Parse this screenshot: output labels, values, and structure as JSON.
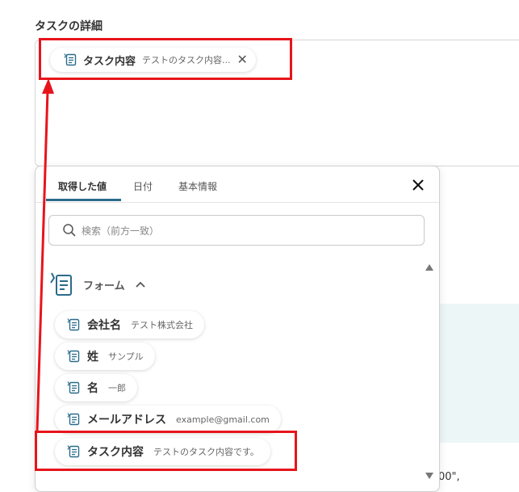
{
  "section": {
    "title": "タスクの詳細"
  },
  "inserted_pill": {
    "label": "タスク内容",
    "value": "テストのタスク内容..."
  },
  "popup": {
    "tabs": [
      {
        "label": "取得した値"
      },
      {
        "label": "日付"
      },
      {
        "label": "基本情報"
      }
    ],
    "search": {
      "placeholder": "検索（前方一致）"
    },
    "group": {
      "title": "フォーム"
    },
    "fields": [
      {
        "label": "会社名",
        "value": "テスト株式会社"
      },
      {
        "label": "姓",
        "value": "サンプル"
      },
      {
        "label": "名",
        "value": "一郎"
      },
      {
        "label": "メールアドレス",
        "value": "example@gmail.com"
      },
      {
        "label": "タスク内容",
        "value": "テストのタスク内容です。"
      }
    ]
  },
  "background": {
    "snippet": "00\","
  },
  "colors": {
    "highlight": "#e8141b",
    "accent": "#2b6b8a",
    "icon": "#2b6b8a"
  }
}
